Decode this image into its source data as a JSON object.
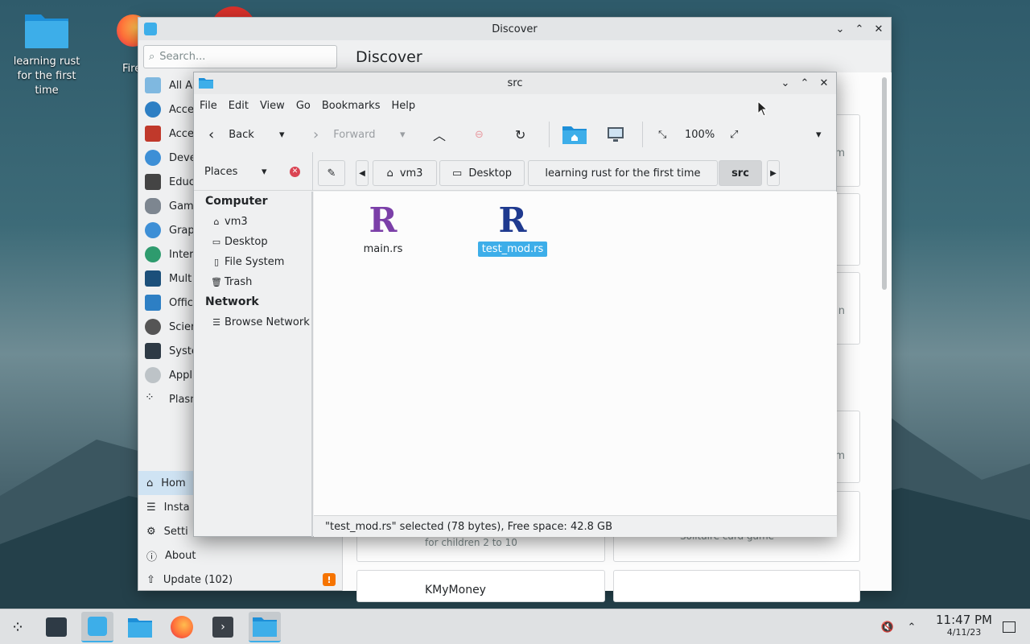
{
  "desktop": {
    "folder_label": "learning rust for the first time",
    "firefox_label": "Fire"
  },
  "discover": {
    "title": "Discover",
    "search_placeholder": "Search...",
    "heading": "Discover",
    "categories": [
      "All Ap",
      "Acce",
      "Acce",
      "Deve",
      "Educ",
      "Gam",
      "Grap",
      "Inter",
      "Mult",
      "Offic",
      "Scier",
      "Syste",
      "Appli",
      "Plasn"
    ],
    "bottom": {
      "home": "Hom",
      "installed": "Insta",
      "settings": "Setti",
      "about": "About",
      "update": "Update (102)",
      "update_badge": "!"
    },
    "partial_texts": {
      "card_m1": "m",
      "card_n": "n",
      "card_m2": "m",
      "children": "for children 2 to 10",
      "card_game": "Solitaire card game",
      "kmymoney": "KMyMoney"
    }
  },
  "dolphin": {
    "title": "src",
    "menu": [
      "File",
      "Edit",
      "View",
      "Go",
      "Bookmarks",
      "Help"
    ],
    "toolbar": {
      "back": "Back",
      "forward": "Forward",
      "zoom": "100%"
    },
    "places_label": "Places",
    "breadcrumbs": [
      "vm3",
      "Desktop",
      "learning rust for the first time",
      "src"
    ],
    "places": {
      "computer_header": "Computer",
      "computer_items": [
        "vm3",
        "Desktop",
        "File System",
        "Trash"
      ],
      "network_header": "Network",
      "network_items": [
        "Browse Network"
      ]
    },
    "files": [
      {
        "name": "main.rs",
        "glyph": "R",
        "color": "#7b3fa8",
        "selected": false
      },
      {
        "name": "test_mod.rs",
        "glyph": "R",
        "color": "#1f3a8f",
        "selected": true
      }
    ],
    "status": "\"test_mod.rs\" selected (78 bytes), Free space: 42.8 GB"
  },
  "taskbar": {
    "time": "11:47 PM",
    "date": "4/11/23"
  },
  "colors": {
    "accent": "#3daee9",
    "rust_main": "#7b3fa8",
    "rust_test": "#1f3a8f"
  }
}
